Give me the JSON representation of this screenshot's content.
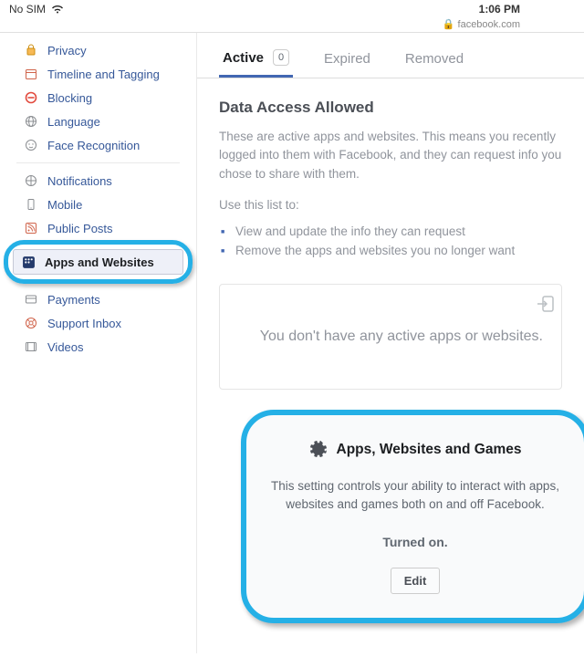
{
  "status": {
    "carrier": "No SIM",
    "time": "1:06 PM"
  },
  "url": {
    "lock": "🔒",
    "text": "facebook.com"
  },
  "sidebar": {
    "group1": [
      {
        "label": "Privacy"
      },
      {
        "label": "Timeline and Tagging"
      },
      {
        "label": "Blocking"
      },
      {
        "label": "Language"
      },
      {
        "label": "Face Recognition"
      }
    ],
    "group2": [
      {
        "label": "Notifications"
      },
      {
        "label": "Mobile"
      },
      {
        "label": "Public Posts"
      }
    ],
    "selected": {
      "label": "Apps and Websites"
    },
    "group3": [
      {
        "label": "Payments"
      },
      {
        "label": "Support Inbox"
      },
      {
        "label": "Videos"
      }
    ]
  },
  "tabs": {
    "active": {
      "label": "Active",
      "count": "0"
    },
    "expired": {
      "label": "Expired"
    },
    "removed": {
      "label": "Removed"
    }
  },
  "section": {
    "title": "Data Access Allowed",
    "desc": "These are active apps and websites. This means you recently logged into them with Facebook, and they can request info you chose to share with them.",
    "sub": "Use this list to:",
    "bullets": [
      "View and update the info they can request",
      "Remove the apps and websites you no longer want"
    ],
    "empty": "You don't have any active apps or websites."
  },
  "card": {
    "title": "Apps, Websites and Games",
    "desc": "This setting controls your ability to interact with apps, websites and games both on and off Facebook.",
    "status": "Turned on.",
    "edit": "Edit"
  }
}
